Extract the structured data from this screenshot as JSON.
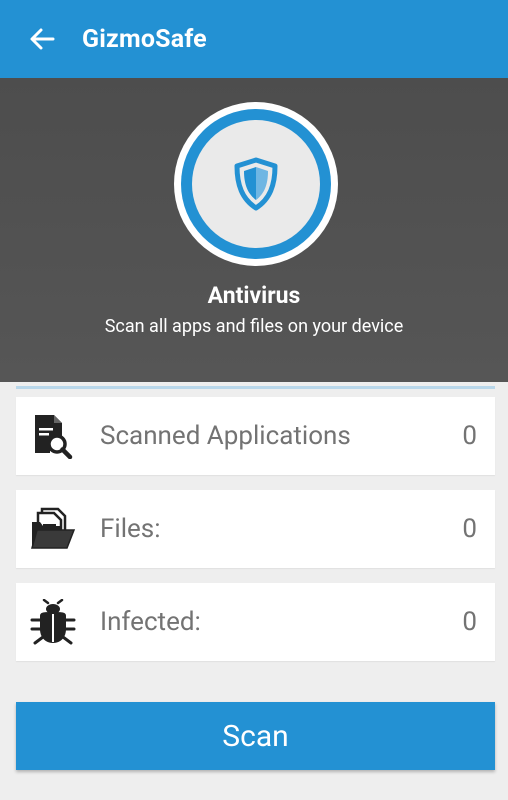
{
  "appbar": {
    "title": "GizmoSafe",
    "back_icon": "arrow-left-icon",
    "color": "#2391d3"
  },
  "hero": {
    "icon": "shield-icon",
    "title": "Antivirus",
    "subtitle": "Scan all apps and files on your device"
  },
  "stats": [
    {
      "icon": "document-search-icon",
      "label": "Scanned Applications",
      "value": "0"
    },
    {
      "icon": "folder-files-icon",
      "label": "Files:",
      "value": "0"
    },
    {
      "icon": "bug-icon",
      "label": "Infected:",
      "value": "0"
    }
  ],
  "actions": {
    "scan_label": "Scan"
  }
}
